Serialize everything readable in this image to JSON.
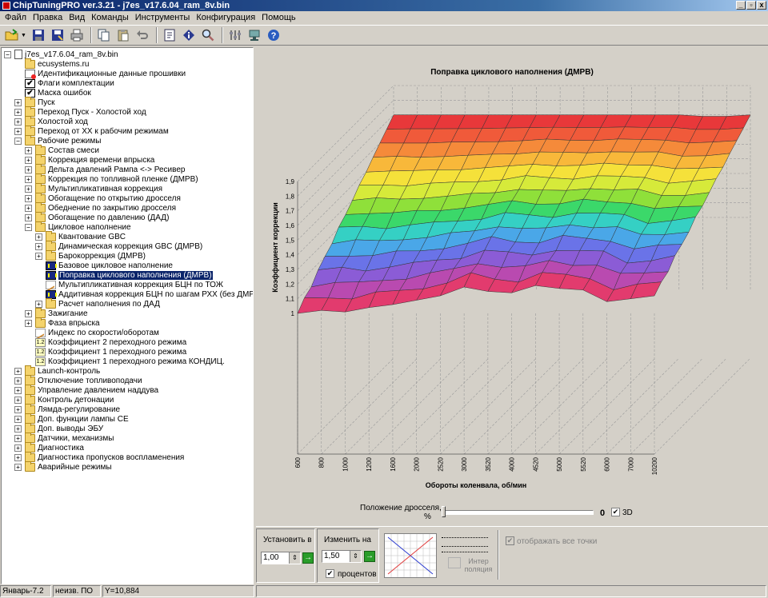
{
  "window": {
    "title": "ChipTuningPRO ver.3.21 - j7es_v17.6.04_ram_8v.bin",
    "min": "_",
    "max": "▫",
    "close": "x"
  },
  "menu": [
    "Файл",
    "Правка",
    "Вид",
    "Команды",
    "Инструменты",
    "Конфигурация",
    "Помощь"
  ],
  "tree": [
    {
      "label": "j7es_v17.6.04_ram_8v.bin",
      "icon": "file",
      "level": 0,
      "exp": "-"
    },
    {
      "label": "ecusystems.ru",
      "icon": "folder",
      "level": 1,
      "exp": ""
    },
    {
      "label": "Идентификационные данные прошивки",
      "icon": "doc",
      "level": 1,
      "exp": ""
    },
    {
      "label": "Флаги комплектации",
      "icon": "check",
      "level": 1,
      "exp": ""
    },
    {
      "label": "Маска ошибок",
      "icon": "check",
      "level": 1,
      "exp": ""
    },
    {
      "label": "Пуск",
      "icon": "folder",
      "level": 1,
      "exp": "+"
    },
    {
      "label": "Переход Пуск - Холостой ход",
      "icon": "folder",
      "level": 1,
      "exp": "+"
    },
    {
      "label": "Холостой ход",
      "icon": "folder",
      "level": 1,
      "exp": "+"
    },
    {
      "label": "Переход от ХХ к рабочим режимам",
      "icon": "folder",
      "level": 1,
      "exp": "+"
    },
    {
      "label": "Рабочие режимы",
      "icon": "folder",
      "level": 1,
      "exp": "-"
    },
    {
      "label": "Состав смеси",
      "icon": "folder",
      "level": 2,
      "exp": "+"
    },
    {
      "label": "Коррекция времени впрыска",
      "icon": "folder",
      "level": 2,
      "exp": "+"
    },
    {
      "label": "Дельта давлений Рампа <-> Ресивер",
      "icon": "folder",
      "level": 2,
      "exp": "+"
    },
    {
      "label": "Коррекция по топливной пленке (ДМРВ)",
      "icon": "folder",
      "level": 2,
      "exp": "+"
    },
    {
      "label": "Мультипликативная коррекция",
      "icon": "folder",
      "level": 2,
      "exp": "+"
    },
    {
      "label": "Обогащение по открытию дросселя",
      "icon": "folder",
      "level": 2,
      "exp": "+"
    },
    {
      "label": "Обеднение по закрытию дросселя",
      "icon": "folder",
      "level": 2,
      "exp": "+"
    },
    {
      "label": "Обогащение по давлению (ДАД)",
      "icon": "folder",
      "level": 2,
      "exp": "+"
    },
    {
      "label": "Цикловое наполнение",
      "icon": "folder",
      "level": 2,
      "exp": "-"
    },
    {
      "label": "Квантование GBC",
      "icon": "folder",
      "level": 3,
      "exp": "+"
    },
    {
      "label": "Динамическая коррекция GBC (ДМРВ)",
      "icon": "folder",
      "level": 3,
      "exp": "+"
    },
    {
      "label": "Барокоррекция (ДМРВ)",
      "icon": "folder",
      "level": 3,
      "exp": "+"
    },
    {
      "label": "Базовое цикловое наполнение",
      "icon": "table",
      "level": 3,
      "exp": ""
    },
    {
      "label": "Поправка циклового наполнения (ДМРВ)",
      "icon": "table",
      "level": 3,
      "exp": "",
      "selected": true
    },
    {
      "label": "Мультипликативная коррекция БЦН по ТОЖ",
      "icon": "graph",
      "level": 3,
      "exp": ""
    },
    {
      "label": "Аддитивная коррекция БЦН по шагам РХХ (без ДМРВ)",
      "icon": "table",
      "level": 3,
      "exp": ""
    },
    {
      "label": "Расчет наполнения по ДАД",
      "icon": "folder",
      "level": 3,
      "exp": "+"
    },
    {
      "label": "Зажигание",
      "icon": "folder",
      "level": 2,
      "exp": "+"
    },
    {
      "label": "Фаза впрыска",
      "icon": "folder",
      "level": 2,
      "exp": "+"
    },
    {
      "label": "Индекс по скорости/оборотам",
      "icon": "graph",
      "level": 2,
      "exp": ""
    },
    {
      "label": "Коэффициент 2 переходного режима",
      "icon": "num",
      "level": 2,
      "exp": ""
    },
    {
      "label": "Коэффициент 1 переходного режима",
      "icon": "num",
      "level": 2,
      "exp": ""
    },
    {
      "label": "Коэффициент 1 переходного режима КОНДИЦ.",
      "icon": "num",
      "level": 2,
      "exp": ""
    },
    {
      "label": "Launch-контроль",
      "icon": "folder",
      "level": 1,
      "exp": "+"
    },
    {
      "label": "Отключение топливоподачи",
      "icon": "folder",
      "level": 1,
      "exp": "+"
    },
    {
      "label": "Управление давлением наддува",
      "icon": "folder",
      "level": 1,
      "exp": "+"
    },
    {
      "label": "Контроль детонации",
      "icon": "folder",
      "level": 1,
      "exp": "+"
    },
    {
      "label": "Лямда-регулирование",
      "icon": "folder",
      "level": 1,
      "exp": "+"
    },
    {
      "label": "Доп. функции лампы CE",
      "icon": "folder",
      "level": 1,
      "exp": "+"
    },
    {
      "label": "Доп. выводы ЭБУ",
      "icon": "folder",
      "level": 1,
      "exp": "+"
    },
    {
      "label": "Датчики, механизмы",
      "icon": "folder",
      "level": 1,
      "exp": "+"
    },
    {
      "label": "Диагностика",
      "icon": "folder",
      "level": 1,
      "exp": "+"
    },
    {
      "label": "Диагностика пропусков воспламенения",
      "icon": "folder",
      "level": 1,
      "exp": "+"
    },
    {
      "label": "Аварийные режимы",
      "icon": "folder",
      "level": 1,
      "exp": "+"
    }
  ],
  "chart_data": {
    "type": "surface3d",
    "title": "Поправка циклового наполнения (ДМРВ)",
    "xlabel": "Обороты коленвала, об/мин",
    "ylabel": "Коэффициент коррекции",
    "zlabel": "Положение дросселя, %",
    "x_categories": [
      "600",
      "800",
      "1000",
      "1200",
      "1600",
      "2000",
      "2520",
      "3000",
      "3520",
      "4000",
      "4520",
      "5000",
      "5520",
      "6000",
      "7000",
      "10200"
    ],
    "yticks": [
      "1",
      "1,1",
      "1,2",
      "1,3",
      "1,4",
      "1,5",
      "1,6",
      "1,7",
      "1,8",
      "1,9"
    ],
    "ylim": [
      1,
      1.9
    ],
    "front_row_values": [
      1.0,
      1.02,
      1.01,
      1.04,
      1.06,
      1.09,
      1.12,
      1.18,
      1.15,
      1.14,
      1.19,
      1.17,
      1.16,
      1.08,
      1.1,
      1.12
    ],
    "back_row_values": [
      1.7,
      1.7,
      1.7,
      1.7,
      1.7,
      1.7,
      1.7,
      1.7,
      1.7,
      1.7,
      1.7,
      1.7,
      1.7,
      1.69,
      1.69,
      1.7
    ],
    "grid": true,
    "color_bands": [
      "#e23b6e",
      "#b94ab0",
      "#8b5cd6",
      "#6a73e8",
      "#4aa7e8",
      "#35d0c4",
      "#3bd86a",
      "#8fe03a",
      "#d6ea3a",
      "#f5e13a",
      "#f8b83a",
      "#f58a3a",
      "#f05a3a",
      "#e8383a"
    ]
  },
  "slider": {
    "label_line1": "Положение дросселя,",
    "label_line2": "%",
    "value": "0",
    "check_3d": "3D"
  },
  "bottom": {
    "set_label": "Установить в",
    "set_value": "1,00",
    "change_label": "Изменить на",
    "change_value": "1,50",
    "percent_label": "процентов",
    "interp_label": "Интер поляция",
    "show_all_label": "отображать все точки"
  },
  "status": [
    "Январь-7.2",
    "неизв. ПО",
    "Y=10,884"
  ]
}
